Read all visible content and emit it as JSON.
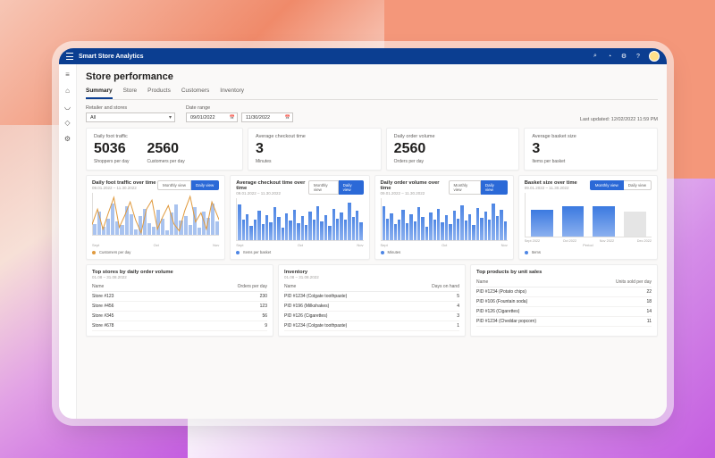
{
  "app": {
    "title": "Smart Store Analytics"
  },
  "page": {
    "title": "Store performance",
    "last_updated_label": "Last updated:",
    "last_updated_value": "12/02/2022 11:59  PM"
  },
  "tabs": [
    {
      "label": "Summary",
      "active": true
    },
    {
      "label": "Store"
    },
    {
      "label": "Products"
    },
    {
      "label": "Customers"
    },
    {
      "label": "Inventory"
    }
  ],
  "filters": {
    "retailer_label": "Retailer and stores",
    "retailer_value": "All",
    "date_label": "Date range",
    "date_from": "09/01/2022",
    "date_to": "11/30/2022"
  },
  "kpis": [
    {
      "label": "Daily foot traffic",
      "value": "5036",
      "sub": "Shoppers per day"
    },
    {
      "label": "",
      "value": "2560",
      "sub": "Customers per day"
    },
    {
      "label": "Average checkout time",
      "value": "3",
      "sub": "Minutes"
    },
    {
      "label": "Daily order volume",
      "value": "2560",
      "sub": "Orders per day"
    },
    {
      "label": "Average basket size",
      "value": "3",
      "sub": "Items per basket"
    }
  ],
  "toggle": {
    "monthly": "Monthly view",
    "daily": "Daily view"
  },
  "charts": {
    "c1": {
      "title": "Daily foot traffic over time",
      "range": "09.01.2022 – 11.30.2022",
      "x": [
        "Sept",
        "Oct",
        "Nov"
      ],
      "legend": "Customers per day"
    },
    "c2": {
      "title": "Average checkout time over time",
      "range": "09.01.2022 – 11.30.2022",
      "x": [
        "Sept",
        "Oct",
        "Nov"
      ],
      "legend": "Items per basket"
    },
    "c3": {
      "title": "Daily order volume over time",
      "range": "09.01.2022 – 11.30.2022",
      "x": [
        "Sept",
        "Oct",
        "Nov"
      ],
      "legend": "Minutes"
    },
    "c4": {
      "title": "Basket size over time",
      "range": "09.01.2022 – 11.30.2022",
      "x": [
        "Sept 2022",
        "Oct 2022",
        "Nov 2022",
        "Dec 2022"
      ],
      "axis_label": "Period",
      "legend": "Items"
    }
  },
  "tables": {
    "top_stores": {
      "title": "Top stores by daily order volume",
      "range": "01.08 – 31.08.2022",
      "cols": [
        "Name",
        "Orders per day"
      ],
      "rows": [
        [
          "Store #123",
          "230"
        ],
        [
          "Store #456",
          "123"
        ],
        [
          "Store #345",
          "56"
        ],
        [
          "Store #678",
          "9"
        ]
      ]
    },
    "inventory": {
      "title": "Inventory",
      "range": "01.08 – 31.08.2022",
      "cols": [
        "Name",
        "Days on hand"
      ],
      "rows": [
        [
          "PID #1234 (Colgate toothpaste)",
          "5"
        ],
        [
          "PID #196 (Milkshakes)",
          "4"
        ],
        [
          "PID #126 (Cigarettes)",
          "3"
        ],
        [
          "PID #1234 (Colgate toothpaste)",
          "1"
        ]
      ]
    },
    "top_products": {
      "title": "Top products by unit sales",
      "range": "",
      "cols": [
        "Name",
        "Units sold per day"
      ],
      "rows": [
        [
          "PID #1234 (Potato chips)",
          "22"
        ],
        [
          "PID #106 (Fountain soda)",
          "18"
        ],
        [
          "PID #126 (Cigarettes)",
          "14"
        ],
        [
          "PID #1234 (Cheddar popcorn)",
          "11"
        ]
      ]
    }
  },
  "chart_data": [
    {
      "id": "daily_foot_traffic_over_time",
      "type": "bar+line",
      "title": "Daily foot traffic over time",
      "xlabel": "",
      "ylabel": "",
      "x_ticks": [
        "Sept",
        "Oct",
        "Nov"
      ],
      "series": [
        {
          "name": "Shoppers per day (bars)",
          "values": [
            20,
            45,
            15,
            30,
            60,
            25,
            18,
            55,
            40,
            10,
            35,
            50,
            22,
            15,
            48,
            30,
            8,
            42,
            58,
            28,
            36,
            18,
            52,
            14,
            44,
            32,
            60,
            26
          ]
        },
        {
          "name": "Customers per day (line)",
          "values": [
            30,
            55,
            18,
            48,
            70,
            22,
            40,
            62,
            35,
            12,
            55,
            68,
            20,
            38,
            58,
            28,
            15,
            50,
            72,
            32,
            46,
            20,
            64,
            18,
            52,
            40,
            76,
            30
          ]
        }
      ]
    },
    {
      "id": "avg_checkout_time_over_time",
      "type": "bar",
      "title": "Average checkout time over time",
      "x_ticks": [
        "Sept",
        "Oct",
        "Nov"
      ],
      "series": [
        {
          "name": "Minutes",
          "values": [
            85,
            50,
            62,
            35,
            48,
            70,
            38,
            60,
            42,
            78,
            55,
            30,
            64,
            46,
            72,
            40,
            58,
            36,
            68,
            50,
            80,
            44,
            60,
            34,
            74,
            52,
            66,
            48,
            90,
            56,
            70,
            42
          ]
        }
      ]
    },
    {
      "id": "daily_order_volume_over_time",
      "type": "bar",
      "title": "Daily order volume over time",
      "x_ticks": [
        "Sept",
        "Oct",
        "Nov"
      ],
      "series": [
        {
          "name": "Orders per day",
          "values": [
            80,
            52,
            64,
            38,
            50,
            72,
            40,
            62,
            44,
            78,
            56,
            32,
            66,
            48,
            74,
            42,
            60,
            38,
            70,
            52,
            82,
            46,
            62,
            36,
            76,
            54,
            68,
            50,
            88,
            58,
            72,
            44
          ]
        }
      ]
    },
    {
      "id": "basket_size_over_time",
      "type": "bar",
      "title": "Basket size over time",
      "xlabel": "Period",
      "categories": [
        "Sept 2022",
        "Oct 2022",
        "Nov 2022",
        "Dec 2022"
      ],
      "values": [
        2.8,
        3.0,
        3.0,
        null
      ],
      "note": "Dec 2022 shown as inactive/placeholder"
    }
  ]
}
